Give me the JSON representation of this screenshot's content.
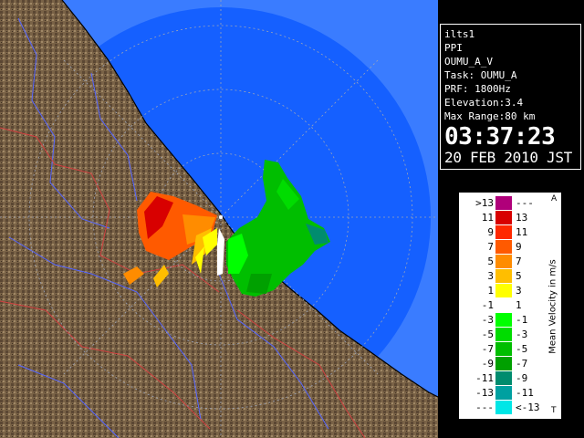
{
  "info": {
    "station": "ilts1",
    "scan_type": "PPI",
    "product": "OUMU_A_V",
    "task": "Task: OUMU_A",
    "prf": "PRF: 1800Hz",
    "elevation": "Elevation:3.4",
    "max_range": "Max Range:80 km",
    "time": "03:37:23",
    "date": "20 FEB 2010 JST"
  },
  "legend": {
    "title": "Mean Velocity in m/s",
    "corner_top": "A",
    "corner_bottom": "T",
    "rows": [
      {
        "left": ">13",
        "right": "---",
        "color": "#b0007a"
      },
      {
        "left": "11",
        "right": "13",
        "color": "#d80000"
      },
      {
        "left": "9",
        "right": "11",
        "color": "#ff2800"
      },
      {
        "left": "7",
        "right": "9",
        "color": "#ff5a00"
      },
      {
        "left": "5",
        "right": "7",
        "color": "#ff8c00"
      },
      {
        "left": "3",
        "right": "5",
        "color": "#ffbe00"
      },
      {
        "left": "1",
        "right": "3",
        "color": "#ffff00"
      },
      {
        "left": "-1",
        "right": "1",
        "color": "#ffffff"
      },
      {
        "left": "-3",
        "right": "-1",
        "color": "#00ff00"
      },
      {
        "left": "-5",
        "right": "-3",
        "color": "#00dc00"
      },
      {
        "left": "-7",
        "right": "-5",
        "color": "#00be00"
      },
      {
        "left": "-9",
        "right": "-7",
        "color": "#00a000"
      },
      {
        "left": "-11",
        "right": "-9",
        "color": "#008c6e"
      },
      {
        "left": "-13",
        "right": "-11",
        "color": "#00a0a0"
      },
      {
        "left": "---",
        "right": "<-13",
        "color": "#00e6e6"
      }
    ]
  },
  "colors": {
    "sea": "#1560ff",
    "sea_outer": "#3a7cff",
    "land": "#7a6347",
    "rivers": "#5566ff",
    "borders": "#d04040"
  }
}
